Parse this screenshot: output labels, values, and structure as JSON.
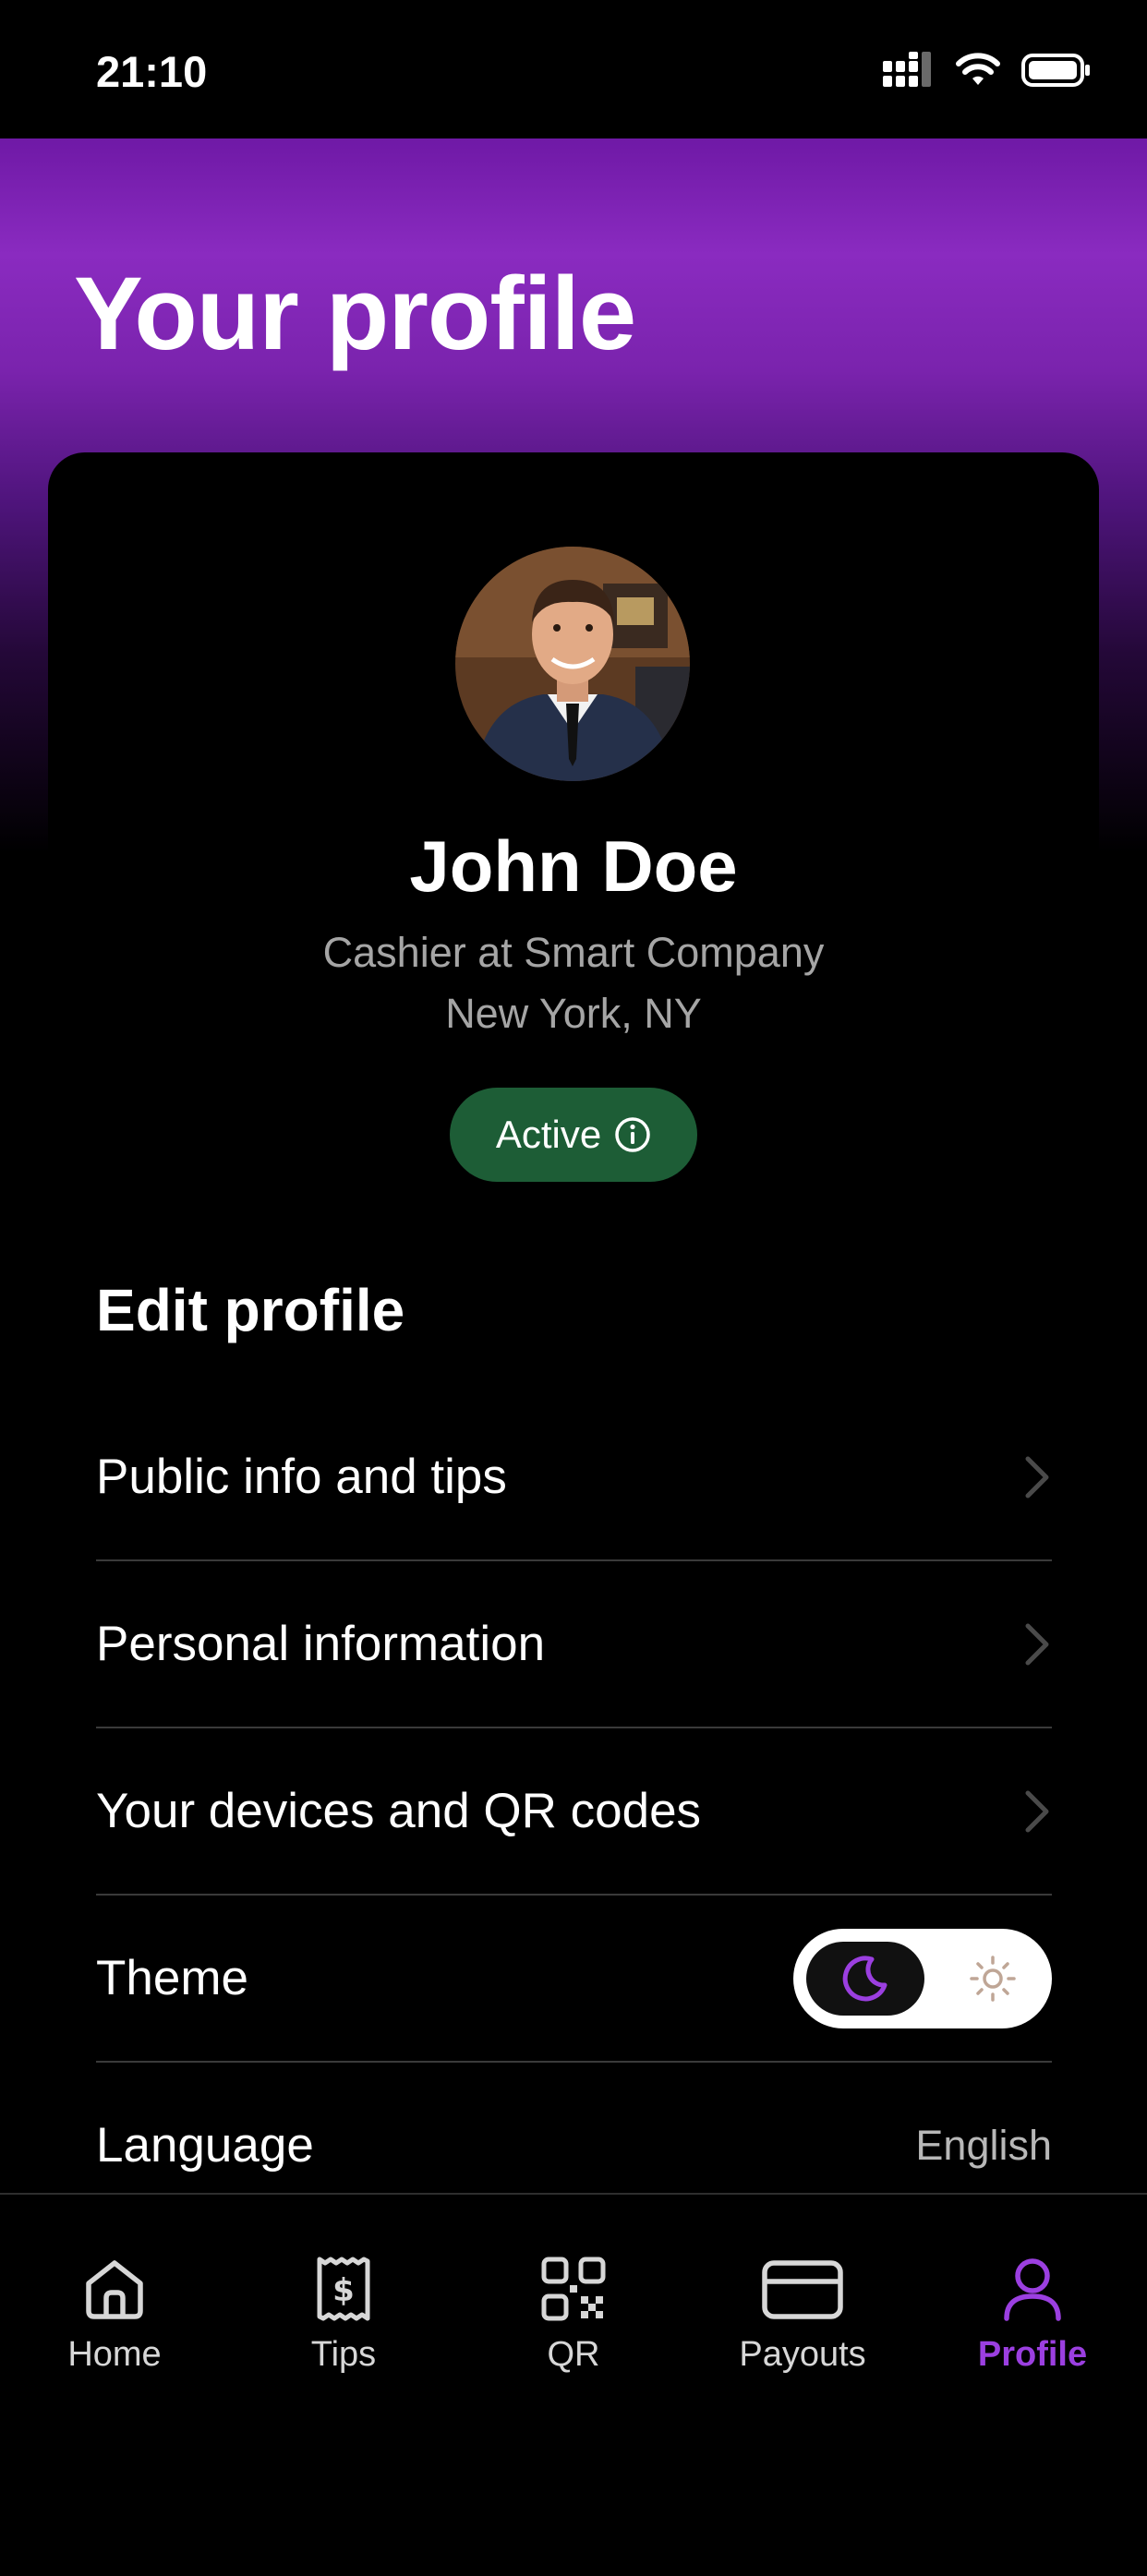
{
  "status_bar": {
    "time": "21:10"
  },
  "header": {
    "title": "Your profile"
  },
  "profile": {
    "name": "John Doe",
    "role": "Cashier at Smart Company",
    "location": "New York, NY",
    "status": "Active"
  },
  "edit_profile": {
    "title": "Edit profile",
    "items": [
      {
        "label": "Public info and tips"
      },
      {
        "label": "Personal information"
      },
      {
        "label": "Your devices and QR codes"
      }
    ],
    "theme": {
      "label": "Theme",
      "selected": "dark"
    },
    "language": {
      "label": "Language",
      "value": "English"
    }
  },
  "tabbar": {
    "items": [
      {
        "label": "Home",
        "icon": "home-icon"
      },
      {
        "label": "Tips",
        "icon": "receipt-dollar-icon"
      },
      {
        "label": "QR",
        "icon": "qr-code-icon"
      },
      {
        "label": "Payouts",
        "icon": "credit-card-icon"
      },
      {
        "label": "Profile",
        "icon": "user-icon"
      }
    ],
    "active": "Profile"
  },
  "colors": {
    "accent": "#9b3fe0",
    "header_gradient": "#8a2bc0",
    "status_active": "#1d5d36",
    "background": "#000000"
  }
}
